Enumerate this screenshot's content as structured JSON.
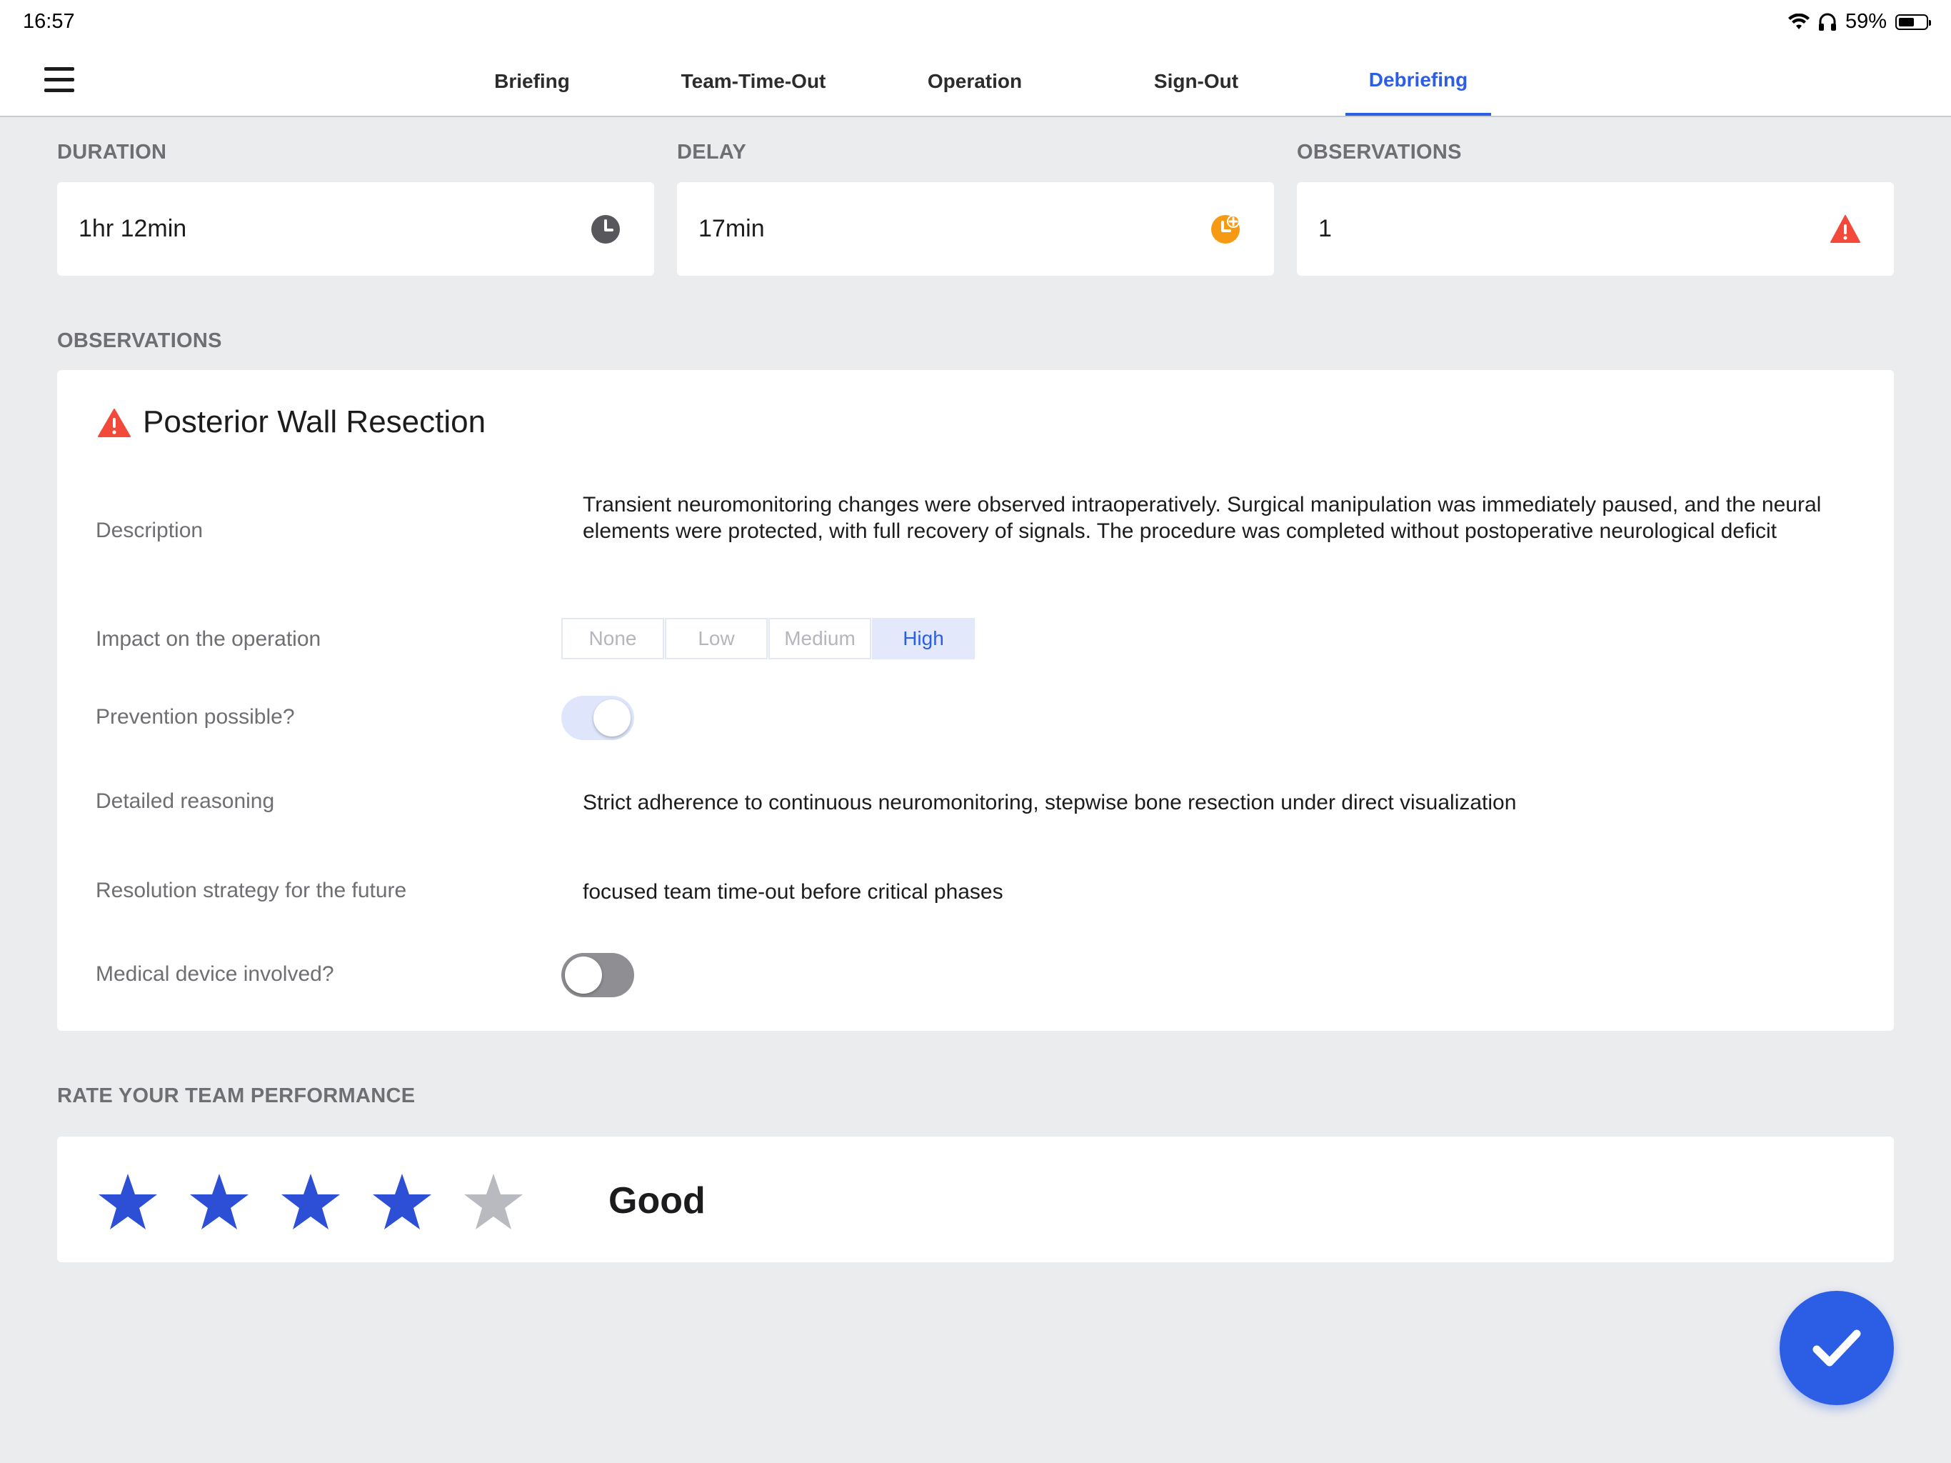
{
  "status_bar": {
    "time": "16:57",
    "battery_text": "59%",
    "battery_level": 0.59,
    "icons": [
      "wifi-icon",
      "headphones-icon",
      "battery-icon"
    ]
  },
  "nav": {
    "menu_icon": "hamburger-menu-icon",
    "tabs": [
      {
        "label": "Briefing",
        "active": false
      },
      {
        "label": "Team-Time-Out",
        "active": false
      },
      {
        "label": "Operation",
        "active": false
      },
      {
        "label": "Sign-Out",
        "active": false
      },
      {
        "label": "Debriefing",
        "active": true
      }
    ]
  },
  "stats": {
    "duration": {
      "label": "DURATION",
      "value": "1hr 12min",
      "icon": "clock-icon"
    },
    "delay": {
      "label": "DELAY",
      "value": "17min",
      "icon": "clock-plus-icon",
      "color": "#f59a12"
    },
    "observations": {
      "label": "OBSERVATIONS",
      "value": "1",
      "icon": "warning-icon",
      "color": "#f2493a"
    }
  },
  "observations_section": {
    "label": "OBSERVATIONS",
    "item": {
      "title": "Posterior Wall Resection",
      "icon": "warning-icon",
      "description_label": "Description",
      "description": "Transient neuromonitoring changes were observed intraoperatively. Surgical manipulation was immediately paused, and the neural elements were protected, with full recovery of signals. The procedure was completed without postoperative neurological deficit",
      "impact_label": "Impact on the operation",
      "impact_options": [
        "None",
        "Low",
        "Medium",
        "High"
      ],
      "impact_selected": "High",
      "prevention_label": "Prevention possible?",
      "prevention_possible": true,
      "reasoning_label": "Detailed reasoning",
      "reasoning": "Strict adherence to continuous neuromonitoring, stepwise bone resection under direct visualization",
      "strategy_label": "Resolution strategy for the future",
      "strategy": "focused team time-out before critical phases",
      "device_label": "Medical device involved?",
      "device_involved": false
    }
  },
  "rating": {
    "label": "RATE YOUR TEAM PERFORMANCE",
    "stars": 4,
    "max_stars": 5,
    "text": "Good",
    "filled_color": "#2c4fd6",
    "empty_color": "#b9bac0"
  },
  "fab": {
    "icon": "checkmark-icon",
    "color": "#2c5de5"
  }
}
